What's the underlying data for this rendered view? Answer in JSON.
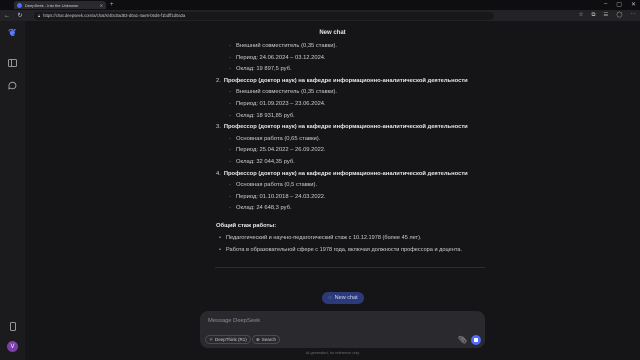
{
  "browser": {
    "tab_title": "DeepSeek - Into the Unknown",
    "new_tab": "+",
    "url": "https://chat.deepseek.com/a/chat/s/4bc0ad83-d0a1-4ae8-b5d6-f1bdff1d0a3a"
  },
  "chat": {
    "title": "New chat",
    "lines": [
      {
        "kind": "sub",
        "text": "Внешний совместитель (0,35 ставки)."
      },
      {
        "kind": "sub",
        "text": "Период: 24.06.2024 – 03.12.2024."
      },
      {
        "kind": "sub",
        "text": "Оклад: 19 897,5 руб."
      },
      {
        "kind": "num",
        "n": "2.",
        "text": "Профессор (доктор наук) на кафедре информационно-аналитической деятельности"
      },
      {
        "kind": "sub",
        "text": "Внешний совместитель (0,35 ставки)."
      },
      {
        "kind": "sub",
        "text": "Период: 01.09.2023 – 23.06.2024."
      },
      {
        "kind": "sub",
        "text": "Оклад: 18 931,85 руб."
      },
      {
        "kind": "num",
        "n": "3.",
        "text": "Профессор (доктор наук) на кафедре информационно-аналитической деятельности"
      },
      {
        "kind": "sub",
        "text": "Основная работа (0,65 ставки)."
      },
      {
        "kind": "sub",
        "text": "Период: 25.04.2022 – 26.09.2022."
      },
      {
        "kind": "sub",
        "text": "Оклад: 32 044,35 руб."
      },
      {
        "kind": "num",
        "n": "4.",
        "text": "Профессор (доктор наук) на кафедре информационно-аналитической деятельности"
      },
      {
        "kind": "sub",
        "text": "Основная работа (0,5 ставки)."
      },
      {
        "kind": "sub",
        "text": "Период: 01.10.2018 – 24.03.2022."
      },
      {
        "kind": "sub",
        "text": "Оклад: 24 648,3 руб."
      }
    ],
    "section_title": "Общий стаж работы:",
    "bullets": [
      "Педагогический и научно-педагогический стаж с 10.12.1978 (более 45 лет).",
      "Работа в образовательной сфере с 1978 года, включая должности профессора и доцента."
    ],
    "new_chat_label": "New chat"
  },
  "composer": {
    "placeholder": "Message DeepSeek",
    "deepthink_label": "DeepThink (R1)",
    "search_label": "Search"
  },
  "footer": {
    "note": "AI-generated, for reference only"
  },
  "user": {
    "avatar_letter": "V"
  },
  "colors": {
    "accent": "#4d6bfe",
    "background": "#151517",
    "avatar": "#7a3ea8"
  }
}
